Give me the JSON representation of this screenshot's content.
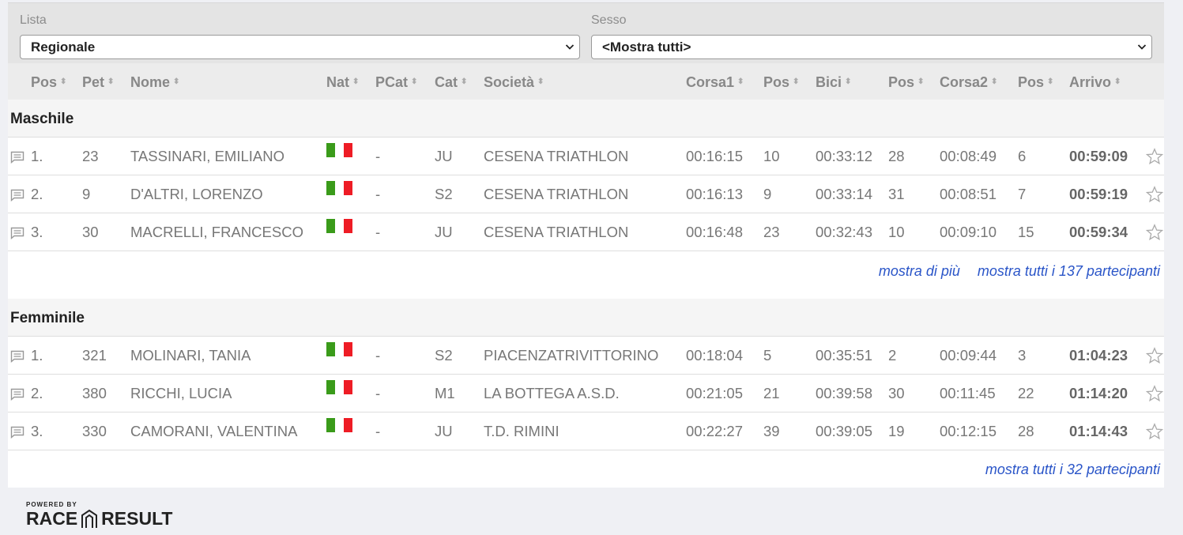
{
  "filters": {
    "lista_label": "Lista",
    "lista_value": "Regionale",
    "sesso_label": "Sesso",
    "sesso_value": "<Mostra tutti>"
  },
  "columns": {
    "pos": "Pos",
    "pet": "Pet",
    "nome": "Nome",
    "nat": "Nat",
    "pcat": "PCat",
    "cat": "Cat",
    "societa": "Società",
    "corsa1": "Corsa1",
    "pos1": "Pos",
    "bici": "Bici",
    "pos2": "Pos",
    "corsa2": "Corsa2",
    "pos3": "Pos",
    "arrivo": "Arrivo"
  },
  "icons": {
    "sort": "sort-arrows-icon",
    "chat": "comment-icon",
    "star": "star-outline-icon",
    "flag": "italy-flag-icon",
    "chevron": "chevron-down-icon"
  },
  "colors": {
    "link": "#2a55c8",
    "flag_green": "#3a9b1a",
    "flag_red": "#ee1c25"
  },
  "groups": [
    {
      "title": "Maschile",
      "rows": [
        {
          "pos": "1.",
          "pet": "23",
          "nome": "TASSINARI, EMILIANO",
          "pcat": "-",
          "cat": "JU",
          "societa": "CESENA TRIATHLON",
          "corsa1": "00:16:15",
          "pos1": "10",
          "bici": "00:33:12",
          "pos2": "28",
          "corsa2": "00:08:49",
          "pos3": "6",
          "arrivo": "00:59:09"
        },
        {
          "pos": "2.",
          "pet": "9",
          "nome": "D'ALTRI, LORENZO",
          "pcat": "-",
          "cat": "S2",
          "societa": "CESENA TRIATHLON",
          "corsa1": "00:16:13",
          "pos1": "9",
          "bici": "00:33:14",
          "pos2": "31",
          "corsa2": "00:08:51",
          "pos3": "7",
          "arrivo": "00:59:19"
        },
        {
          "pos": "3.",
          "pet": "30",
          "nome": "MACRELLI, FRANCESCO",
          "pcat": "-",
          "cat": "JU",
          "societa": "CESENA TRIATHLON",
          "corsa1": "00:16:48",
          "pos1": "23",
          "bici": "00:32:43",
          "pos2": "10",
          "corsa2": "00:09:10",
          "pos3": "15",
          "arrivo": "00:59:34"
        }
      ],
      "show_more": "mostra di più",
      "show_all": "mostra tutti i 137 partecipanti"
    },
    {
      "title": "Femminile",
      "rows": [
        {
          "pos": "1.",
          "pet": "321",
          "nome": "MOLINARI, TANIA",
          "pcat": "-",
          "cat": "S2",
          "societa": "PIACENZATRIVITTORINO",
          "corsa1": "00:18:04",
          "pos1": "5",
          "bici": "00:35:51",
          "pos2": "2",
          "corsa2": "00:09:44",
          "pos3": "3",
          "arrivo": "01:04:23"
        },
        {
          "pos": "2.",
          "pet": "380",
          "nome": "RICCHI, LUCIA",
          "pcat": "-",
          "cat": "M1",
          "societa": "LA BOTTEGA A.S.D.",
          "corsa1": "00:21:05",
          "pos1": "21",
          "bici": "00:39:58",
          "pos2": "30",
          "corsa2": "00:11:45",
          "pos3": "22",
          "arrivo": "01:14:20"
        },
        {
          "pos": "3.",
          "pet": "330",
          "nome": "CAMORANI, VALENTINA",
          "pcat": "-",
          "cat": "JU",
          "societa": "T.D. RIMINI",
          "corsa1": "00:22:27",
          "pos1": "39",
          "bici": "00:39:05",
          "pos2": "19",
          "corsa2": "00:12:15",
          "pos3": "28",
          "arrivo": "01:14:43"
        }
      ],
      "show_all": "mostra tutti i 32 partecipanti"
    }
  ],
  "footer": {
    "powered_by": "POWERED BY",
    "brand_left": "RACE",
    "brand_right": "RESULT"
  }
}
